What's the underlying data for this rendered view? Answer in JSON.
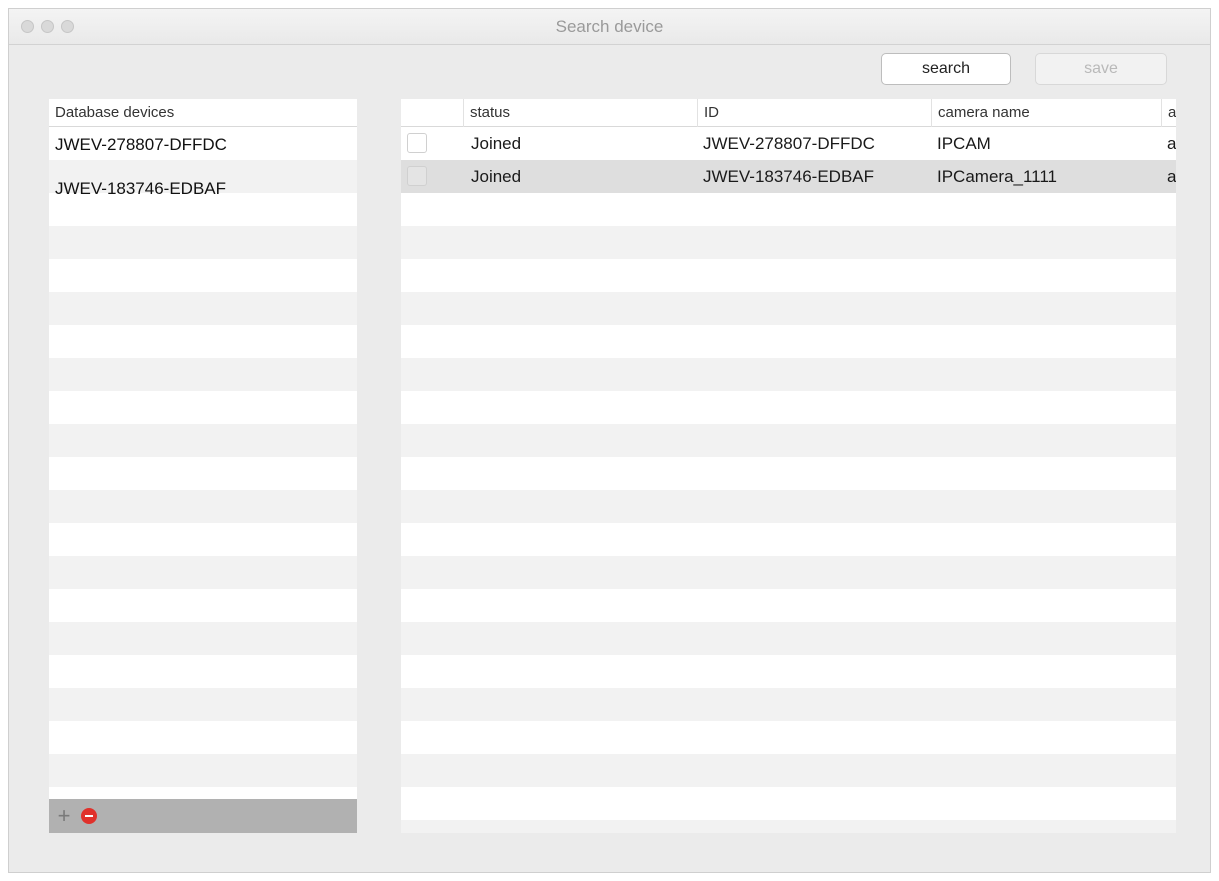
{
  "window": {
    "title": "Search device"
  },
  "toolbar": {
    "search_label": "search",
    "save_label": "save"
  },
  "left_list": {
    "header": "Database devices",
    "items": [
      "JWEV-278807-DFFDC",
      "JWEV-183746-EDBAF"
    ]
  },
  "table": {
    "columns": [
      "status",
      "ID",
      "camera name",
      "a"
    ],
    "rows": [
      {
        "status": "Joined",
        "id": "JWEV-278807-DFFDC",
        "camera_name": "IPCAM",
        "extra": "a"
      },
      {
        "status": "Joined",
        "id": "JWEV-183746-EDBAF",
        "camera_name": "IPCamera_1111",
        "extra": "a"
      }
    ]
  },
  "icons": {
    "add": "plus-icon",
    "remove": "minus-circle-icon"
  },
  "colors": {
    "remove_icon": "#e0312b",
    "selected_row": "#dedede"
  }
}
